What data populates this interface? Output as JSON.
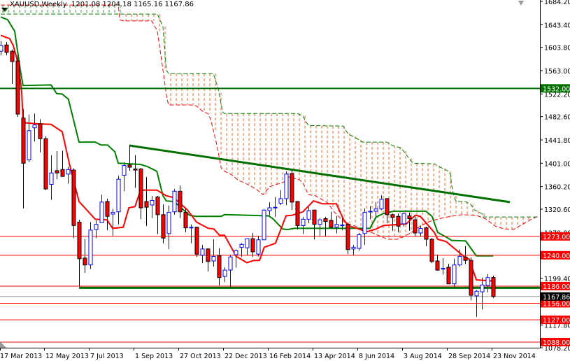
{
  "header": {
    "symbol": "XAUUSD,Weekly",
    "ohlc": "1201.08 1204.18 1165.16 1167.86"
  },
  "colors": {
    "bull": "#0000ff",
    "bear": "#ff0000",
    "tenkan": "#ff0000",
    "kijun": "#008000",
    "cloud_bear": "#ff5a1f",
    "cloud_bull": "#2e9e3e",
    "level": "#ff0000",
    "support": "#007000",
    "current": "#000000"
  },
  "chart_data": {
    "type": "candlestick",
    "symbol": "XAUUSD",
    "timeframe": "Weekly",
    "ylim": [
      1078.2,
      1684.2
    ],
    "y_ticks": [
      "1684.20",
      "1643.40",
      "1603.80",
      "1563.00",
      "1522.20",
      "1482.60",
      "1441.80",
      "1401.00",
      "1360.20",
      "1320.60",
      "1279.80",
      "1239.00",
      "1199.40",
      "1158.60",
      "1117.80",
      "1078.20"
    ],
    "x_labels": [
      {
        "index": 0,
        "label": "17 Mar 2013"
      },
      {
        "index": 8,
        "label": "12 May 2013"
      },
      {
        "index": 16,
        "label": "7 Jul 2013"
      },
      {
        "index": 24,
        "label": "1 Sep 2013"
      },
      {
        "index": 32,
        "label": "27 Oct 2013"
      },
      {
        "index": 40,
        "label": "22 Dec 2013"
      },
      {
        "index": 48,
        "label": "16 Feb 2014"
      },
      {
        "index": 56,
        "label": "13 Apr 2014"
      },
      {
        "index": 64,
        "label": "8 Jun 2014"
      },
      {
        "index": 72,
        "label": "3 Aug 2014"
      },
      {
        "index": 80,
        "label": "28 Sep 2014"
      },
      {
        "index": 88,
        "label": "23 Nov 2014"
      }
    ],
    "candles_ohlc": [
      [
        1597,
        1615,
        1590,
        1607
      ],
      [
        1608,
        1613,
        1590,
        1595
      ],
      [
        1597,
        1600,
        1540,
        1579
      ],
      [
        1580,
        1590,
        1482,
        1487
      ],
      [
        1480,
        1496,
        1322,
        1401
      ],
      [
        1407,
        1486,
        1403,
        1458
      ],
      [
        1463,
        1488,
        1439,
        1468
      ],
      [
        1470,
        1478,
        1420,
        1444
      ],
      [
        1444,
        1448,
        1354,
        1356
      ],
      [
        1364,
        1415,
        1337,
        1384
      ],
      [
        1388,
        1422,
        1373,
        1384
      ],
      [
        1390,
        1423,
        1377,
        1378
      ],
      [
        1382,
        1395,
        1365,
        1390
      ],
      [
        1389,
        1392,
        1270,
        1292
      ],
      [
        1298,
        1302,
        1186,
        1234
      ],
      [
        1235,
        1268,
        1209,
        1223
      ],
      [
        1223,
        1298,
        1216,
        1284
      ],
      [
        1285,
        1301,
        1270,
        1294
      ],
      [
        1297,
        1346,
        1297,
        1333
      ],
      [
        1334,
        1339,
        1284,
        1308
      ],
      [
        1312,
        1321,
        1274,
        1315
      ],
      [
        1316,
        1379,
        1294,
        1373
      ],
      [
        1380,
        1403,
        1352,
        1397
      ],
      [
        1398,
        1433,
        1388,
        1394
      ],
      [
        1391,
        1415,
        1358,
        1389
      ],
      [
        1391,
        1393,
        1303,
        1323
      ],
      [
        1334,
        1377,
        1291,
        1324
      ],
      [
        1328,
        1344,
        1305,
        1336
      ],
      [
        1342,
        1344,
        1277,
        1311
      ],
      [
        1311,
        1329,
        1261,
        1270
      ],
      [
        1278,
        1327,
        1251,
        1315
      ],
      [
        1316,
        1356,
        1311,
        1352
      ],
      [
        1352,
        1362,
        1305,
        1316
      ],
      [
        1315,
        1323,
        1280,
        1288
      ],
      [
        1288,
        1294,
        1261,
        1289
      ],
      [
        1289,
        1290,
        1237,
        1242
      ],
      [
        1240,
        1258,
        1226,
        1251
      ],
      [
        1251,
        1252,
        1212,
        1229
      ],
      [
        1230,
        1268,
        1220,
        1238
      ],
      [
        1239,
        1252,
        1187,
        1201
      ],
      [
        1203,
        1219,
        1193,
        1214
      ],
      [
        1214,
        1240,
        1182,
        1237
      ],
      [
        1241,
        1250,
        1218,
        1248
      ],
      [
        1254,
        1261,
        1237,
        1259
      ],
      [
        1253,
        1269,
        1240,
        1269
      ],
      [
        1269,
        1279,
        1237,
        1246
      ],
      [
        1242,
        1274,
        1238,
        1267
      ],
      [
        1267,
        1321,
        1267,
        1319
      ],
      [
        1318,
        1333,
        1310,
        1323
      ],
      [
        1324,
        1342,
        1307,
        1324
      ],
      [
        1331,
        1354,
        1328,
        1339
      ],
      [
        1339,
        1387,
        1328,
        1382
      ],
      [
        1383,
        1389,
        1319,
        1333
      ],
      [
        1334,
        1335,
        1285,
        1292
      ],
      [
        1292,
        1307,
        1277,
        1303
      ],
      [
        1303,
        1324,
        1296,
        1318
      ],
      [
        1319,
        1320,
        1268,
        1294
      ],
      [
        1294,
        1305,
        1274,
        1302
      ],
      [
        1304,
        1307,
        1273,
        1299
      ],
      [
        1301,
        1316,
        1286,
        1289
      ],
      [
        1289,
        1309,
        1278,
        1294
      ],
      [
        1293,
        1305,
        1284,
        1293
      ],
      [
        1294,
        1297,
        1242,
        1250
      ],
      [
        1251,
        1258,
        1240,
        1254
      ],
      [
        1252,
        1279,
        1248,
        1276
      ],
      [
        1278,
        1322,
        1258,
        1315
      ],
      [
        1316,
        1326,
        1303,
        1317
      ],
      [
        1317,
        1333,
        1306,
        1321
      ],
      [
        1321,
        1345,
        1319,
        1338
      ],
      [
        1339,
        1340,
        1296,
        1311
      ],
      [
        1311,
        1313,
        1283,
        1306
      ],
      [
        1308,
        1313,
        1280,
        1291
      ],
      [
        1295,
        1315,
        1290,
        1313
      ],
      [
        1309,
        1315,
        1283,
        1304
      ],
      [
        1302,
        1310,
        1273,
        1279
      ],
      [
        1279,
        1292,
        1273,
        1287
      ],
      [
        1288,
        1290,
        1256,
        1268
      ],
      [
        1268,
        1270,
        1226,
        1229
      ],
      [
        1230,
        1241,
        1213,
        1214
      ],
      [
        1216,
        1235,
        1206,
        1217
      ],
      [
        1219,
        1225,
        1190,
        1190
      ],
      [
        1190,
        1234,
        1182,
        1223
      ],
      [
        1223,
        1250,
        1220,
        1238
      ],
      [
        1237,
        1256,
        1225,
        1231
      ],
      [
        1231,
        1236,
        1161,
        1170
      ],
      [
        1169,
        1179,
        1132,
        1177
      ],
      [
        1176,
        1201,
        1145,
        1188
      ],
      [
        1187,
        1207,
        1175,
        1201
      ],
      [
        1201.08,
        1204.18,
        1165.16,
        1167.86
      ]
    ],
    "tenkan_sen": [
      [
        0,
        1625
      ],
      [
        1.6,
        1619
      ],
      [
        2.25,
        1607
      ],
      [
        3.1,
        1576
      ],
      [
        3.75,
        1527
      ],
      [
        4,
        1472
      ],
      [
        6.6,
        1470
      ],
      [
        9,
        1469
      ],
      [
        11,
        1456
      ],
      [
        12.25,
        1401
      ],
      [
        14,
        1334
      ],
      [
        16.9,
        1303
      ],
      [
        19,
        1302
      ],
      [
        20,
        1287
      ],
      [
        21.9,
        1289
      ],
      [
        22.9,
        1323
      ],
      [
        24,
        1325
      ],
      [
        25,
        1354
      ],
      [
        27.9,
        1354
      ],
      [
        29.6,
        1344
      ],
      [
        30.9,
        1341
      ],
      [
        33.4,
        1319
      ],
      [
        35,
        1298
      ],
      [
        37.1,
        1287
      ],
      [
        38.1,
        1286
      ],
      [
        39.1,
        1275
      ],
      [
        40,
        1275
      ],
      [
        42.1,
        1238
      ],
      [
        44,
        1227
      ],
      [
        45.25,
        1231
      ],
      [
        46.25,
        1231
      ],
      [
        47.1,
        1254
      ],
      [
        49.1,
        1261
      ],
      [
        51,
        1309
      ],
      [
        52.1,
        1310
      ],
      [
        54,
        1316
      ],
      [
        55.9,
        1335
      ],
      [
        57.5,
        1330
      ],
      [
        60,
        1330
      ],
      [
        61.25,
        1303
      ],
      [
        62.1,
        1292
      ],
      [
        64.6,
        1284
      ],
      [
        65.4,
        1281
      ],
      [
        67.1,
        1286
      ],
      [
        68.4,
        1292
      ],
      [
        72.5,
        1295
      ],
      [
        74.1,
        1310
      ],
      [
        75,
        1308
      ],
      [
        77.5,
        1280
      ],
      [
        78.1,
        1268
      ],
      [
        79.6,
        1264
      ],
      [
        82.9,
        1237
      ],
      [
        83.75,
        1233
      ],
      [
        85,
        1197
      ],
      [
        88,
        1195
      ]
    ],
    "kijun_sen": [
      [
        0,
        1657
      ],
      [
        1.25,
        1652
      ],
      [
        2.5,
        1632
      ],
      [
        3.5,
        1564
      ],
      [
        4,
        1537
      ],
      [
        9,
        1538
      ],
      [
        10,
        1523
      ],
      [
        11,
        1522
      ],
      [
        12.1,
        1513
      ],
      [
        14,
        1438
      ],
      [
        16.9,
        1438
      ],
      [
        17.9,
        1433
      ],
      [
        19.1,
        1433
      ],
      [
        20.4,
        1421
      ],
      [
        21,
        1401
      ],
      [
        25,
        1399
      ],
      [
        26.25,
        1395
      ],
      [
        27.9,
        1387
      ],
      [
        29,
        1344
      ],
      [
        29.6,
        1335
      ],
      [
        31,
        1334
      ],
      [
        32.25,
        1323
      ],
      [
        33.75,
        1310
      ],
      [
        35,
        1308
      ],
      [
        39.4,
        1308
      ],
      [
        40,
        1311
      ],
      [
        47.9,
        1309
      ],
      [
        48.75,
        1303
      ],
      [
        50.4,
        1286
      ],
      [
        51.25,
        1285
      ],
      [
        52.5,
        1287
      ],
      [
        66,
        1287
      ],
      [
        67.1,
        1307
      ],
      [
        68.4,
        1313
      ],
      [
        70.25,
        1317
      ],
      [
        76,
        1317
      ],
      [
        77.1,
        1308
      ],
      [
        78.1,
        1280
      ],
      [
        79.6,
        1272
      ],
      [
        80.6,
        1266
      ],
      [
        83.1,
        1265
      ],
      [
        85,
        1239
      ],
      [
        88,
        1239
      ]
    ],
    "senkou_span_a": [
      [
        0,
        1678
      ],
      [
        21,
        1678
      ],
      [
        21.3,
        1652
      ],
      [
        22,
        1650
      ],
      [
        27,
        1650
      ],
      [
        28,
        1632
      ],
      [
        29,
        1564
      ],
      [
        29.7,
        1515
      ],
      [
        30,
        1503
      ],
      [
        34,
        1503
      ],
      [
        35,
        1501
      ],
      [
        36.2,
        1491
      ],
      [
        37,
        1488
      ],
      [
        37.5,
        1479
      ],
      [
        38.7,
        1430
      ],
      [
        39.4,
        1393
      ],
      [
        40,
        1387
      ],
      [
        41.25,
        1381
      ],
      [
        42.5,
        1371
      ],
      [
        43.75,
        1366
      ],
      [
        45.6,
        1356
      ],
      [
        46.9,
        1346
      ],
      [
        48.1,
        1360
      ],
      [
        49.6,
        1365
      ],
      [
        50.6,
        1368
      ],
      [
        51.5,
        1377
      ],
      [
        53.4,
        1372
      ],
      [
        54.1,
        1365
      ],
      [
        55,
        1346
      ],
      [
        56.25,
        1344
      ],
      [
        58.4,
        1332
      ],
      [
        59.6,
        1316
      ],
      [
        61.25,
        1299
      ],
      [
        62.1,
        1295
      ],
      [
        63.4,
        1291
      ],
      [
        65,
        1283
      ],
      [
        66.25,
        1280
      ],
      [
        67.9,
        1273
      ],
      [
        69.1,
        1268
      ],
      [
        70.9,
        1268
      ],
      [
        72.1,
        1273
      ],
      [
        73.4,
        1280
      ],
      [
        75,
        1291
      ],
      [
        76.6,
        1299
      ],
      [
        78.4,
        1304
      ],
      [
        80.4,
        1308
      ],
      [
        82.5,
        1311
      ],
      [
        85,
        1310
      ],
      [
        86.6,
        1304
      ],
      [
        88.4,
        1291
      ],
      [
        90,
        1286
      ],
      [
        91.6,
        1285
      ],
      [
        93.4,
        1295
      ],
      [
        95,
        1304
      ],
      [
        96,
        1308
      ]
    ],
    "senkou_span_b": [
      [
        0,
        1662
      ],
      [
        28,
        1662
      ],
      [
        29,
        1640
      ],
      [
        29.6,
        1564
      ],
      [
        30,
        1558
      ],
      [
        38,
        1558
      ],
      [
        38.8,
        1534
      ],
      [
        39.7,
        1490
      ],
      [
        40,
        1488
      ],
      [
        53,
        1488
      ],
      [
        54,
        1484
      ],
      [
        54.4,
        1476
      ],
      [
        55,
        1467
      ],
      [
        61.2,
        1466
      ],
      [
        62.1,
        1452
      ],
      [
        63,
        1448
      ],
      [
        64,
        1442
      ],
      [
        64.7,
        1438
      ],
      [
        69,
        1438
      ],
      [
        70,
        1432
      ],
      [
        71.5,
        1428
      ],
      [
        72.2,
        1420
      ],
      [
        73.1,
        1408
      ],
      [
        73.7,
        1401
      ],
      [
        77.5,
        1400
      ],
      [
        78,
        1397
      ],
      [
        79,
        1392
      ],
      [
        80,
        1387
      ],
      [
        80.4,
        1381
      ],
      [
        80.6,
        1362
      ],
      [
        81,
        1344
      ],
      [
        81.2,
        1338
      ],
      [
        81.5,
        1334
      ],
      [
        83,
        1334
      ],
      [
        84,
        1329
      ],
      [
        84.7,
        1319
      ],
      [
        86,
        1313
      ],
      [
        86.2,
        1307
      ],
      [
        96,
        1307
      ]
    ],
    "trendline": [
      [
        23,
        1432
      ],
      [
        91,
        1333
      ]
    ],
    "support_line": {
      "from_index": 14,
      "price": 1183
    },
    "horizontal_1532": {
      "price": 1532.0,
      "label": "1532.00"
    },
    "levels": [
      {
        "price": 1273.0,
        "label": "1273.00"
      },
      {
        "price": 1240.0,
        "label": "1240.00"
      },
      {
        "price": 1186.0,
        "label": "1186.00"
      },
      {
        "price": 1156.0,
        "label": "1156.00"
      },
      {
        "price": 1127.0,
        "label": "1127.00"
      },
      {
        "price": 1088.0,
        "label": "1088.00"
      }
    ],
    "current_price": {
      "price": 1167.86,
      "label": "1167.86"
    }
  }
}
